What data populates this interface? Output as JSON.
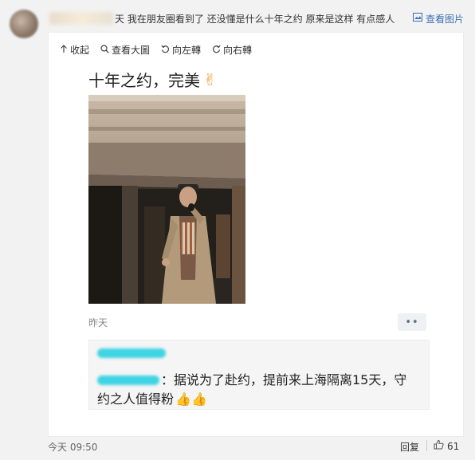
{
  "post": {
    "headline": "天 我在朋友圈看到了 还没懂是什么十年之约 原来是这样 有点感人",
    "view_pic_label": "查看图片"
  },
  "toolbar": {
    "collapse": "收起",
    "view_large": "查看大圖",
    "rotate_left": "向左轉",
    "rotate_right": "向右轉"
  },
  "image_post": {
    "caption": "十年之约，完美",
    "victory_glyph": "✌",
    "time": "昨天",
    "more": "••"
  },
  "comment": {
    "text_line1": "：据说为了赴约，提前来上海隔离15天，守",
    "text_line2": "约之人值得粉",
    "thumbs": "👍👍"
  },
  "footer": {
    "time": "今天 09:50",
    "reply": "回复",
    "likes": "61"
  },
  "colors": {
    "link": "#3c6fb8",
    "redaction": "#3fd4e4"
  },
  "icons": [
    "avatar",
    "image-icon",
    "collapse-icon",
    "search-icon",
    "rotate-left-icon",
    "rotate-right-icon",
    "thumbs-up-icon"
  ]
}
